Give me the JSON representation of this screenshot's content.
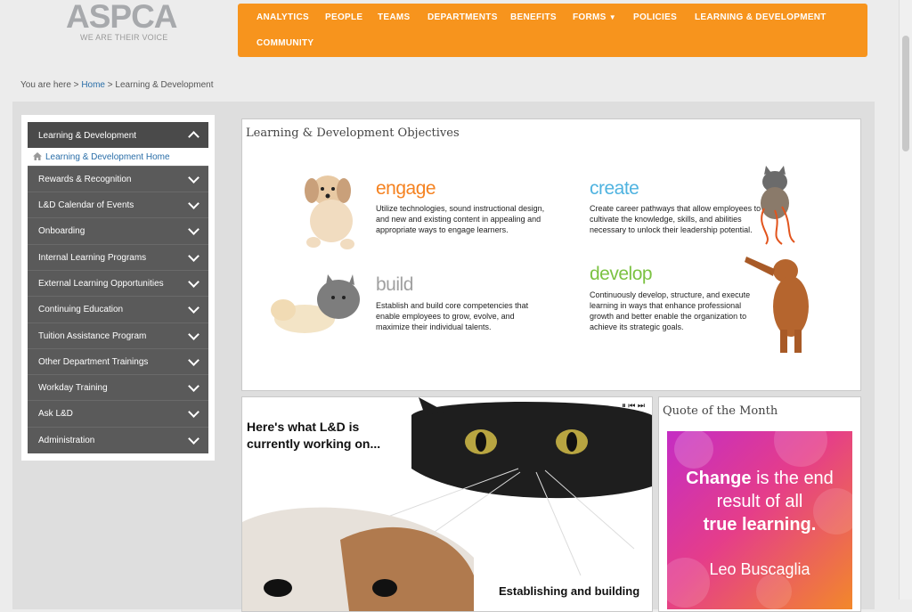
{
  "logo": {
    "text": "ASPCA",
    "tagline": "WE ARE THEIR VOICE"
  },
  "nav": {
    "items": [
      "ANALYTICS",
      "PEOPLE",
      "TEAMS",
      "DEPARTMENTS",
      "BENEFITS",
      "FORMS",
      "POLICIES",
      "LEARNING & DEVELOPMENT",
      "COMMUNITY"
    ]
  },
  "breadcrumb": {
    "prefix": "You are here >",
    "home": "Home",
    "sep": ">",
    "current": "Learning & Development"
  },
  "sidebar": {
    "header": "Learning & Development",
    "sub": "Learning & Development Home",
    "items": [
      "Rewards & Recognition",
      "L&D Calendar of Events",
      "Onboarding",
      "Internal Learning Programs",
      "External Learning Opportunities",
      "Continuing Education",
      "Tuition Assistance Program",
      "Other Department Trainings",
      "Workday Training",
      "Ask L&D",
      "Administration"
    ]
  },
  "objectives": {
    "title": "Learning & Development Objectives",
    "engage": {
      "head": "engage",
      "text": "Utilize technologies, sound instructional design, and new and existing content in appealing and appropriate ways to engage learners.",
      "color": "#f58220"
    },
    "create": {
      "head": "create",
      "text": "Create career pathways that allow employees to cultivate the knowledge, skills, and abilities necessary to unlock their leadership potential.",
      "color": "#4fb3e0"
    },
    "build": {
      "head": "build",
      "text": "Establish and build core competencies that enable employees to grow, evolve, and maximize their individual talents.",
      "color": "#a0a0a0"
    },
    "develop": {
      "head": "develop",
      "text": "Continuously develop, structure, and execute learning in ways that enhance professional growth and better enable the organization to achieve its strategic goals.",
      "color": "#7cc242"
    }
  },
  "slider": {
    "headline": "Here's what L&D is currently working on...",
    "footer": "Establishing and building",
    "controls": "⏸ ⏮ ⏭"
  },
  "quote": {
    "title": "Quote of the Month",
    "text_a": "Change",
    "text_b": "is the end result of all",
    "text_c": "true learning.",
    "author": "Leo Buscaglia"
  }
}
